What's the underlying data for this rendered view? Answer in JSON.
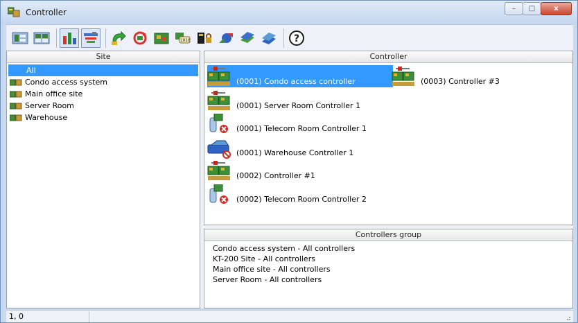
{
  "window": {
    "title": "Controller"
  },
  "caption_buttons": {
    "minimize": "–",
    "maximize": "□",
    "close": "x"
  },
  "toolbar": {
    "buttons": [
      {
        "icon": "controller-list-icon"
      },
      {
        "icon": "controller-grid-icon"
      },
      {
        "icon": "bar-chart-icon"
      },
      {
        "icon": "network-tree-icon"
      },
      {
        "icon": "green-arrow-icon"
      },
      {
        "icon": "refresh-red-icon"
      },
      {
        "icon": "board-icon"
      },
      {
        "icon": "binary-transfer-icon"
      },
      {
        "icon": "controller-lock-icon"
      },
      {
        "icon": "sync-icon"
      },
      {
        "icon": "stack-icon"
      },
      {
        "icon": "stack-blue-icon"
      },
      {
        "icon": "help-icon"
      }
    ]
  },
  "site_pane": {
    "header": "Site",
    "items": [
      {
        "label": "All",
        "selected": true
      },
      {
        "label": "Condo access system"
      },
      {
        "label": "Main office site"
      },
      {
        "label": "Server Room"
      },
      {
        "label": "Warehouse"
      }
    ]
  },
  "controller_pane": {
    "header": "Controller",
    "items": [
      {
        "label": "(0001) Condo access controller",
        "icon": "controller-board-icon",
        "selected": true
      },
      {
        "label": "(0003) Controller #3",
        "icon": "controller-board-icon"
      },
      {
        "label": "(0001) Server Room Controller 1",
        "icon": "controller-board-icon"
      },
      {
        "label": "(0001) Telecom Room Controller 1",
        "icon": "telecom-error-icon"
      },
      {
        "label": "(0001) Warehouse Controller 1",
        "icon": "warehouse-controller-icon"
      },
      {
        "label": "(0002) Controller #1",
        "icon": "controller-board-icon"
      },
      {
        "label": "(0002) Telecom Room Controller 2",
        "icon": "telecom-error-icon"
      }
    ]
  },
  "group_pane": {
    "header": "Controllers group",
    "items": [
      "Condo access system - All controllers",
      "KT-200 Site - All controllers",
      "Main office site - All controllers",
      "Server Room - All controllers"
    ]
  },
  "statusbar": {
    "position": "1, 0"
  }
}
